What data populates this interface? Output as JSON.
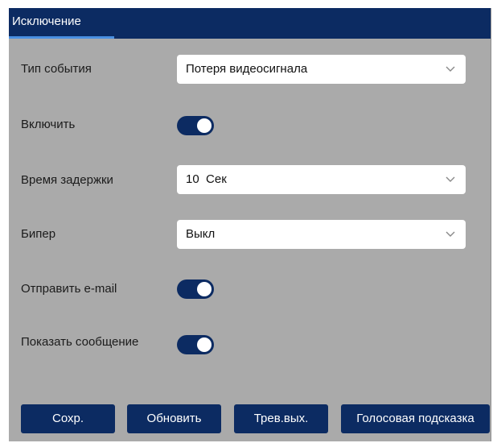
{
  "header": {
    "tab_label": "Исключение"
  },
  "form": {
    "event_type": {
      "label": "Тип события",
      "value": "Потеря видеосигнала"
    },
    "enable": {
      "label": "Включить",
      "on": true
    },
    "delay": {
      "label": "Время задержки",
      "value": "10  Сек"
    },
    "beeper": {
      "label": "Бипер",
      "value": "Выкл"
    },
    "send_email": {
      "label": "Отправить e-mail",
      "on": true
    },
    "show_message": {
      "label": "Показать сообщение",
      "on": true
    }
  },
  "buttons": {
    "save": "Сохр.",
    "refresh": "Обновить",
    "alarm_out": "Трев.вых.",
    "voice_prompt": "Голосовая подсказка"
  },
  "colors": {
    "accent": "#0c2b62",
    "tab_underline": "#4a90e2",
    "panel_bg": "#aaaaaa"
  }
}
